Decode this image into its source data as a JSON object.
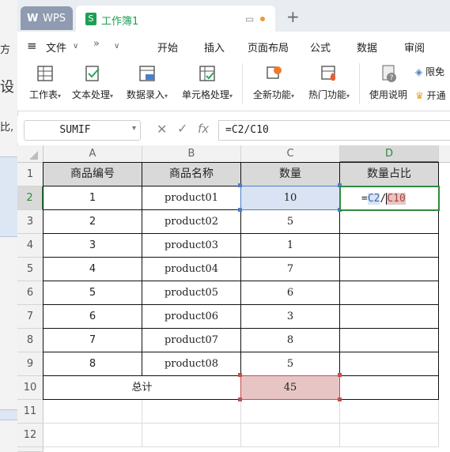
{
  "tabs": {
    "wps_label": "WPS",
    "wps_logo": "W",
    "doc_label": "工作簿1",
    "add_label": "+"
  },
  "background_window": {
    "line1": "方",
    "line2": "设",
    "line3": "比,"
  },
  "menu": {
    "file": "文件",
    "more": "»",
    "items": [
      "开始",
      "插入",
      "页面布局",
      "公式",
      "数据",
      "审阅"
    ]
  },
  "ribbon": {
    "buttons": [
      {
        "label": "工作表",
        "icon": "table-grid-icon"
      },
      {
        "label": "文本处理",
        "icon": "text-check-icon"
      },
      {
        "label": "数据录入",
        "icon": "data-entry-icon"
      },
      {
        "label": "单元格处理",
        "icon": "cell-process-icon"
      },
      {
        "label": "全新功能",
        "icon": "new-feature-icon"
      },
      {
        "label": "热门功能",
        "icon": "hot-feature-icon"
      },
      {
        "label": "使用说明",
        "icon": "manual-icon"
      }
    ],
    "limited": "限免",
    "open": "开通"
  },
  "formula_bar": {
    "name_box": "SUMIF",
    "fx": "fx",
    "formula": "=C2/C10"
  },
  "columns": [
    "A",
    "B",
    "C",
    "D"
  ],
  "rows": [
    "1",
    "2",
    "3",
    "4",
    "5",
    "6",
    "7",
    "8",
    "9",
    "10",
    "11",
    "12"
  ],
  "table": {
    "headers": [
      "商品编号",
      "商品名称",
      "数量",
      "数量占比"
    ],
    "data": [
      [
        "1",
        "product01",
        "10"
      ],
      [
        "2",
        "product02",
        "5"
      ],
      [
        "3",
        "product03",
        "1"
      ],
      [
        "4",
        "product04",
        "7"
      ],
      [
        "5",
        "product05",
        "6"
      ],
      [
        "6",
        "product06",
        "3"
      ],
      [
        "7",
        "product07",
        "8"
      ],
      [
        "8",
        "product08",
        "5"
      ]
    ],
    "total_label": "总计",
    "total_value": "45",
    "edit": {
      "eq": "=",
      "ref1": "C2",
      "op": "/",
      "ref2": "C10"
    }
  },
  "colors": {
    "green": "#1e9e56",
    "c2_fill": "#dae3f3",
    "c10_fill": "#e8c5c5",
    "active_border": "#2e8b3e"
  }
}
